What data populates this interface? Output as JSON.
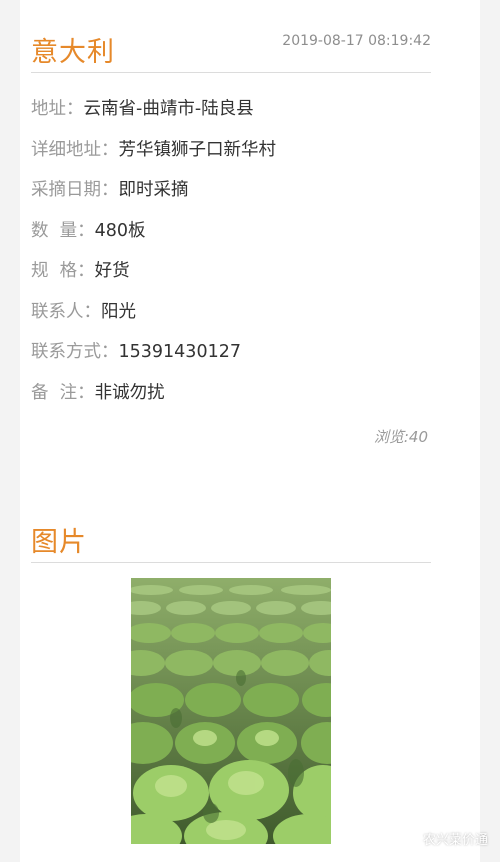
{
  "header": {
    "title": "意大利",
    "datetime": "2019-08-17 08:19:42"
  },
  "details": [
    {
      "label": "地址：",
      "value": "云南省-曲靖市-陆良县"
    },
    {
      "label": "详细地址：",
      "value": "芳华镇狮子口新华村"
    },
    {
      "label": "采摘日期：",
      "value": "即时采摘"
    },
    {
      "label": "数  量：",
      "value": "480板"
    },
    {
      "label": "规  格：",
      "value": "好货"
    },
    {
      "label": "联系人：",
      "value": "阳光"
    },
    {
      "label": "联系方式：",
      "value": "15391430127"
    },
    {
      "label": "备  注：",
      "value": "非诚勿扰"
    }
  ],
  "views": "浏览:40",
  "images_section": {
    "title": "图片",
    "photo_icon": "lettuce-field-photo"
  },
  "watermark": {
    "text": "农兴菜价通",
    "icon": "wechat-icon"
  }
}
